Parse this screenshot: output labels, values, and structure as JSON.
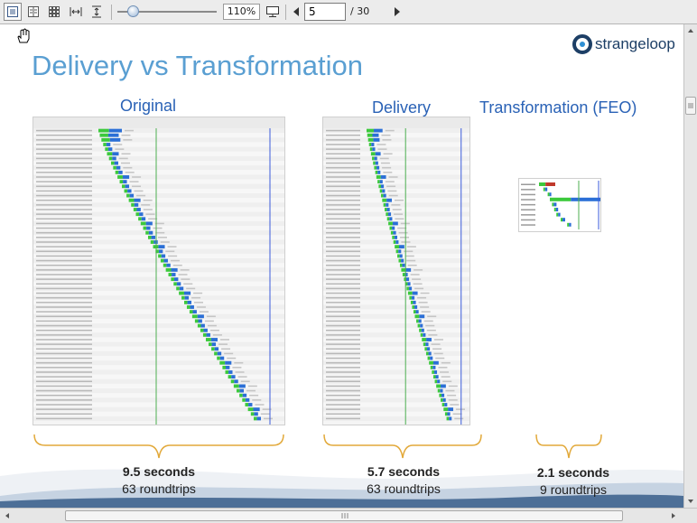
{
  "toolbar": {
    "zoom": "110%",
    "page_current": "5",
    "page_total": "/ 30"
  },
  "slide": {
    "title": "Delivery vs Transformation",
    "logo_text": "strangeloop",
    "columns": [
      {
        "heading": "Original",
        "seconds": "9.5 seconds",
        "roundtrips": "63 roundtrips"
      },
      {
        "heading": "Delivery",
        "seconds": "5.7 seconds",
        "roundtrips": "63 roundtrips"
      },
      {
        "heading": "Transformation (FEO)",
        "seconds": "2.1 seconds",
        "roundtrips": "9 roundtrips"
      }
    ]
  },
  "colors": {
    "title": "#5a9fd2",
    "heading": "#2a62b6",
    "bracket": "#e2a93a",
    "bar_green": "#3cc93c",
    "bar_blue": "#2b6fd6"
  }
}
